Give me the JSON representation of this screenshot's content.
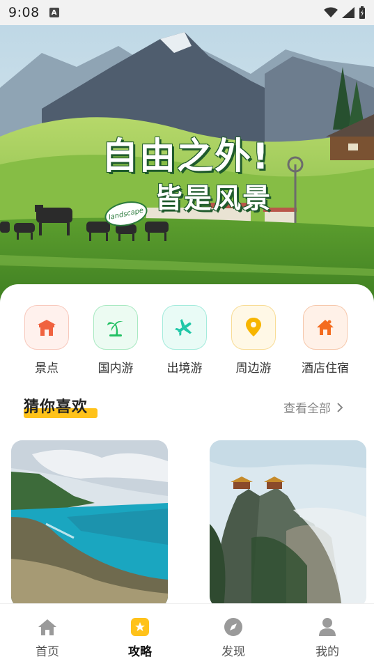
{
  "status_bar": {
    "time": "9:08",
    "notification_badge": "A"
  },
  "hero": {
    "title_line1": "自由之外!",
    "title_line2": "皆是风景",
    "badge_text": "landscape"
  },
  "categories": [
    {
      "label": "景点",
      "icon": "temple-icon",
      "color": "#f0623f",
      "bg": "#fff1ed",
      "border": "#f8c9bd"
    },
    {
      "label": "国内游",
      "icon": "palm-tree-icon",
      "color": "#22c063",
      "bg": "#ecfbf2",
      "border": "#a9e9c2"
    },
    {
      "label": "出境游",
      "icon": "airplane-icon",
      "color": "#1fc7a7",
      "bg": "#e9fbf6",
      "border": "#a4ebdc"
    },
    {
      "label": "周边游",
      "icon": "location-pin-icon",
      "color": "#f7b500",
      "bg": "#fff8e6",
      "border": "#f8dc96"
    },
    {
      "label": "酒店住宿",
      "icon": "house-icon",
      "color": "#f46b1e",
      "bg": "#fff1e8",
      "border": "#f6c8ac"
    }
  ],
  "recommend": {
    "title": "猜你喜欢",
    "see_all": "查看全部"
  },
  "tabs": [
    {
      "label": "首页",
      "icon": "home-icon",
      "active": false
    },
    {
      "label": "攻略",
      "icon": "star-badge-icon",
      "active": true
    },
    {
      "label": "发现",
      "icon": "compass-icon",
      "active": false
    },
    {
      "label": "我的",
      "icon": "person-icon",
      "active": false
    }
  ],
  "colors": {
    "accent": "#ffc21a",
    "text": "#222222"
  }
}
